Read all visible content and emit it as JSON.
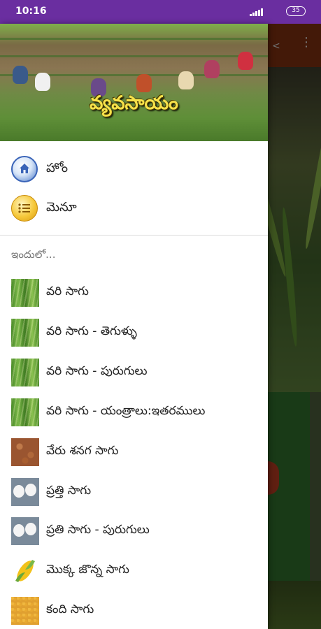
{
  "status_bar": {
    "time": "10:16",
    "battery": "35"
  },
  "drawer": {
    "header_title": "వ్యవసాయం",
    "nav_items": [
      {
        "label": "హోం",
        "icon": "home-icon"
      },
      {
        "label": "మెనూ",
        "icon": "menu-list-icon"
      }
    ],
    "section_label": "ఇందులో...",
    "items": [
      {
        "label": "వరి సాగు",
        "thumb": "paddy"
      },
      {
        "label": "వరి సాగు - తెగుళ్ళు",
        "thumb": "paddy"
      },
      {
        "label": "వరి సాగు - పురుగులు",
        "thumb": "paddy"
      },
      {
        "label": "వరి సాగు - యంత్రాలు:ఇతరములు",
        "thumb": "paddy"
      },
      {
        "label": "వేరు శనగ సాగు",
        "thumb": "groundnut"
      },
      {
        "label": "ప్రత్తి సాగు",
        "thumb": "cotton"
      },
      {
        "label": "ప్రతి సాగు - పురుగులు",
        "thumb": "cotton"
      },
      {
        "label": "మొక్క జొన్న సాగు",
        "thumb": "maize"
      },
      {
        "label": "కంది సాగు",
        "thumb": "dal"
      }
    ]
  }
}
